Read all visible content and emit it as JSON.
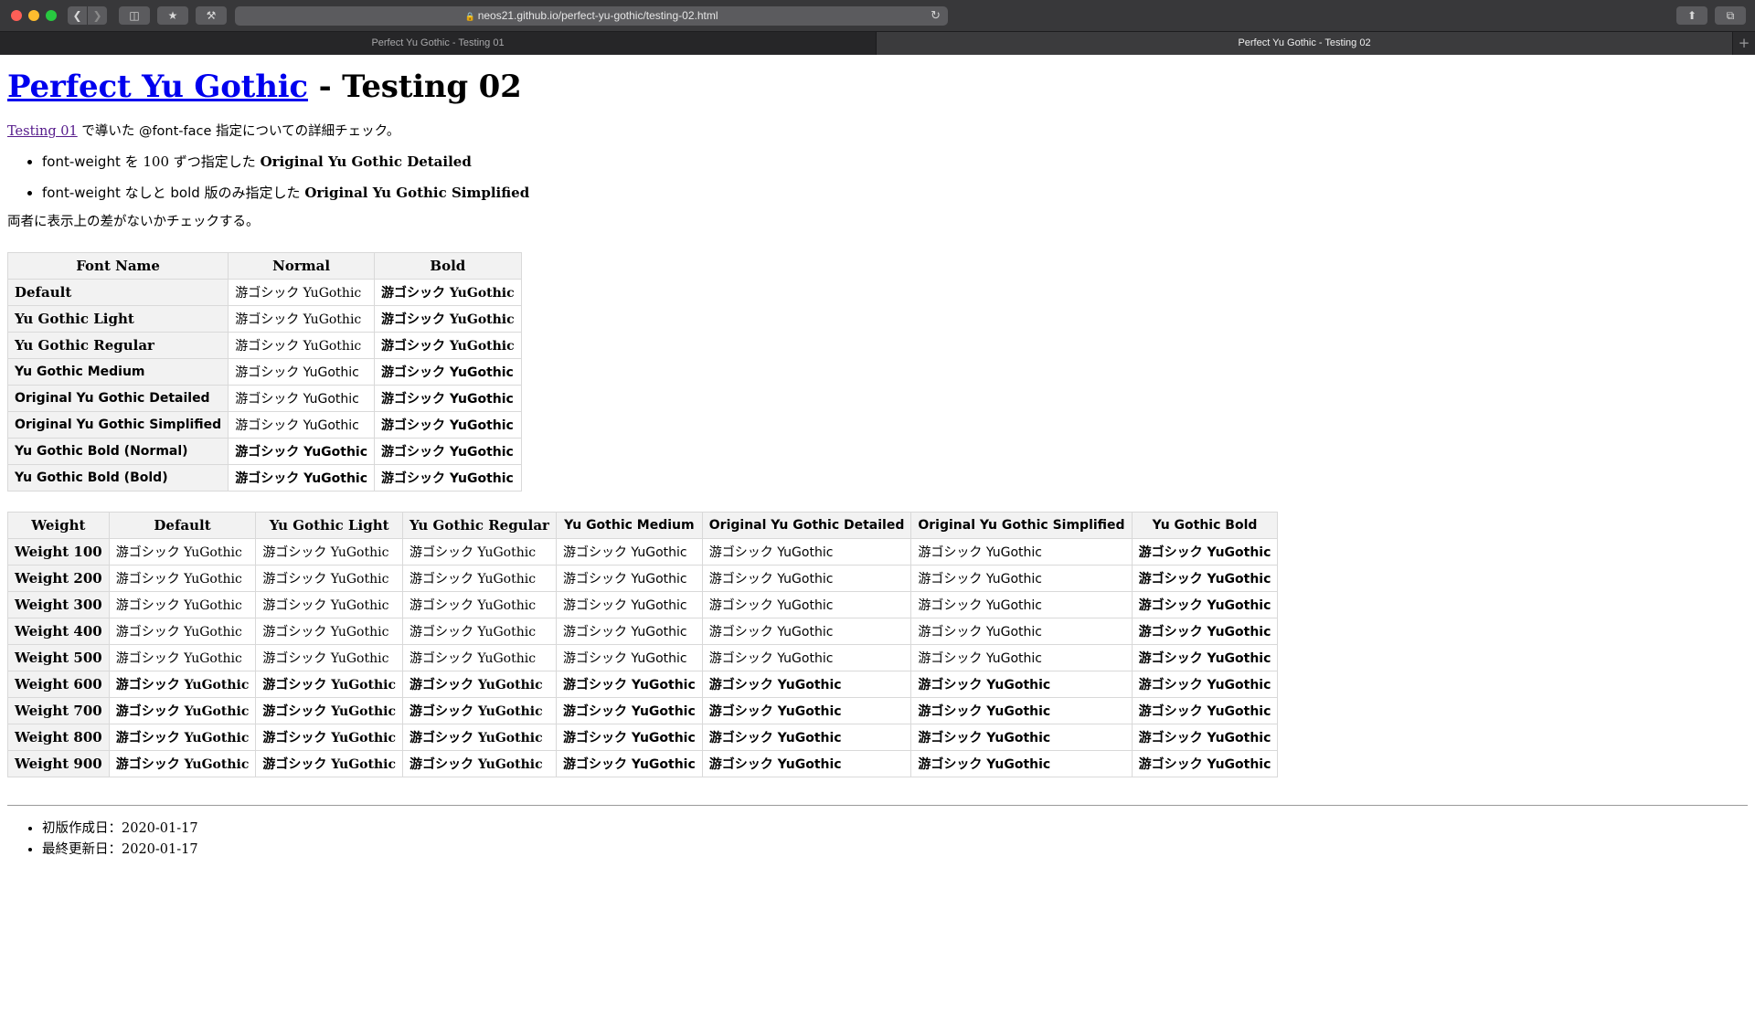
{
  "browser": {
    "url": "neos21.github.io/perfect-yu-gothic/testing-02.html",
    "tabs": [
      {
        "label": "Perfect Yu Gothic - Testing 01"
      },
      {
        "label": "Perfect Yu Gothic - Testing 02"
      }
    ]
  },
  "page": {
    "title_link": "Perfect Yu Gothic",
    "title_rest": " - Testing 02",
    "intro_link": "Testing 01",
    "intro_text1": " で導いた ",
    "intro_code": "@font-face",
    "intro_text2": " 指定についての詳細チェック。",
    "bullet1_a": "font-weight",
    "bullet1_b": " を 100 ずつ指定した ",
    "bullet1_c": "Original Yu Gothic Detailed",
    "bullet2_a": "font-weight",
    "bullet2_b": " なしと ",
    "bullet2_c": "bold",
    "bullet2_d": " 版のみ指定した ",
    "bullet2_e": "Original Yu Gothic Simplified",
    "conclusion": "両者に表示上の差がないかチェックする。",
    "sample": "游ゴシック YuGothic"
  },
  "table1": {
    "headers": [
      "Font Name",
      "Normal",
      "Bold"
    ],
    "rows": [
      "Default",
      "Yu Gothic Light",
      "Yu Gothic Regular",
      "Yu Gothic Medium",
      "Original Yu Gothic Detailed",
      "Original Yu Gothic Simplified",
      "Yu Gothic Bold (Normal)",
      "Yu Gothic Bold (Bold)"
    ]
  },
  "table2": {
    "headers": [
      "Weight",
      "Default",
      "Yu Gothic Light",
      "Yu Gothic Regular",
      "Yu Gothic Medium",
      "Original Yu Gothic Detailed",
      "Original Yu Gothic Simplified",
      "Yu Gothic Bold"
    ],
    "rows": [
      "Weight 100",
      "Weight 200",
      "Weight 300",
      "Weight 400",
      "Weight 500",
      "Weight 600",
      "Weight 700",
      "Weight 800",
      "Weight 900"
    ]
  },
  "footer": {
    "created": "初版作成日：2020-01-17",
    "updated": "最終更新日：2020-01-17"
  }
}
